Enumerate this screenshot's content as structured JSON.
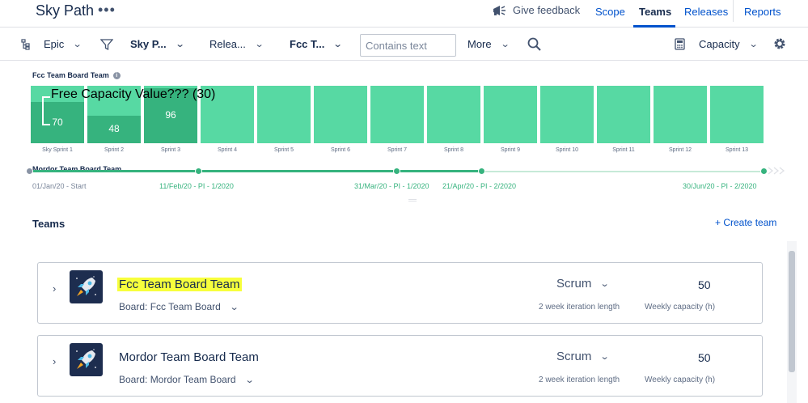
{
  "header": {
    "app_title": "Sky Path",
    "more_icon": "•••",
    "feedback_label": "Give feedback",
    "tabs": [
      {
        "label": "Scope"
      },
      {
        "label": "Teams"
      },
      {
        "label": "Releases"
      },
      {
        "label": "Reports"
      }
    ],
    "active_tab": "Teams"
  },
  "toolbar": {
    "hierarchy": "Epic",
    "project_filter": "Sky P...",
    "release_filter": "Relea...",
    "team_filter": "Fcc T...",
    "search_placeholder": "Contains text",
    "more_label": "More",
    "view_label": "Capacity"
  },
  "capacity_chart": {
    "title": "Fcc Team Board Team",
    "annotation": "Free Capacity Value??? (30)",
    "sprints": [
      {
        "label": "Sky Sprint 1",
        "value": "70",
        "fill": 0.72
      },
      {
        "label": "Sprint 2",
        "value": "48",
        "fill": 0.48
      },
      {
        "label": "Sprint 3",
        "value": "96",
        "fill": 0.96
      },
      {
        "label": "Sprint 4",
        "value": "",
        "fill": 0
      },
      {
        "label": "Sprint 5",
        "value": "",
        "fill": 0
      },
      {
        "label": "Sprint 6",
        "value": "",
        "fill": 0
      },
      {
        "label": "Sprint 7",
        "value": "",
        "fill": 0
      },
      {
        "label": "Sprint 8",
        "value": "",
        "fill": 0
      },
      {
        "label": "Sprint 9",
        "value": "",
        "fill": 0
      },
      {
        "label": "Sprint 10",
        "value": "",
        "fill": 0
      },
      {
        "label": "Sprint 11",
        "value": "",
        "fill": 0
      },
      {
        "label": "Sprint 12",
        "value": "",
        "fill": 0
      },
      {
        "label": "Sprint 13",
        "value": "",
        "fill": 0
      }
    ],
    "colors": {
      "capacity": "#57d9a3",
      "used": "#36b37e"
    }
  },
  "timeline": {
    "hidden_title": "Mordor Team Board Team",
    "start_label": "01/Jan/20 - Start",
    "milestones": [
      "11/Feb/20 - PI - 1/2020",
      "31/Mar/20 - PI - 1/2020",
      "21/Apr/20 - PI - 2/2020",
      "30/Jun/20 - PI - 2/2020"
    ]
  },
  "teams_section": {
    "title": "Teams",
    "create_label": "+ Create team",
    "teams": [
      {
        "name": "Fcc Team Board Team",
        "board": "Board: Fcc Team Board",
        "methodology": "Scrum",
        "iteration_length": "2 week iteration length",
        "capacity": "50",
        "capacity_label": "Weekly capacity (h)",
        "highlight_color": "#f7ff3c"
      },
      {
        "name": "Mordor Team Board Team",
        "board": "Board: Mordor Team Board",
        "methodology": "Scrum",
        "iteration_length": "2 week iteration length",
        "capacity": "50",
        "capacity_label": "Weekly capacity (h)"
      }
    ]
  }
}
